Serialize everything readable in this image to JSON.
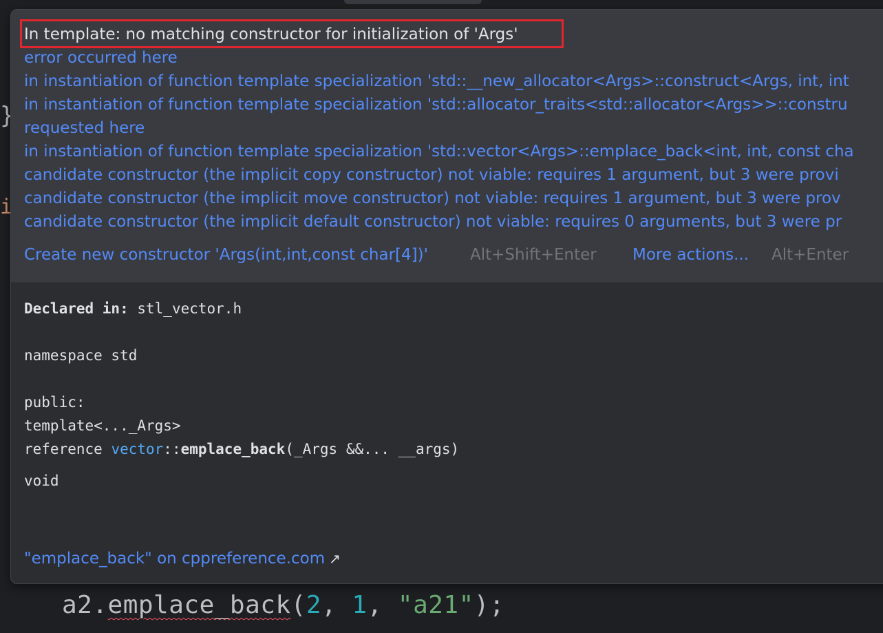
{
  "editor": {
    "brace_fragment": "}",
    "i_fragment": "i",
    "code_line": {
      "object": "a2.",
      "method": "emplace_back",
      "open": "(",
      "arg1": "2",
      "sep1": ", ",
      "arg2": "1",
      "sep2": ", ",
      "arg3": "\"a21\"",
      "close": ");"
    }
  },
  "popup": {
    "error_title": "In template: no matching constructor for initialization of 'Args'",
    "messages": [
      "error occurred here",
      "in instantiation of function template specialization 'std::__new_allocator<Args>::construct<Args, int, int",
      "in instantiation of function template specialization 'std::allocator_traits<std::allocator<Args>>::constru",
      "requested here",
      "in instantiation of function template specialization 'std::vector<Args>::emplace_back<int, int, const cha",
      "candidate constructor (the implicit copy constructor) not viable: requires 1 argument, but 3 were provi",
      "candidate constructor (the implicit move constructor) not viable: requires 1 argument, but 3 were prov",
      "candidate constructor (the implicit default constructor) not viable: requires 0 arguments, but 3 were pr"
    ],
    "actions": {
      "create_constructor_label": "Create new constructor 'Args(int,int,const char[4])'",
      "create_constructor_shortcut": "Alt+Shift+Enter",
      "more_actions_label": "More actions...",
      "more_actions_shortcut": "Alt+Enter"
    },
    "docs": {
      "declared_label": "Declared in:",
      "declared_file": "stl_vector.h",
      "namespace_line": "namespace std",
      "access_line": "public:",
      "template_line": "template<..._Args>",
      "sig_return": "reference ",
      "sig_class": "vector",
      "sig_scope": "::",
      "sig_method": "emplace_back",
      "sig_params": "(_Args &&... __args)",
      "return_type": "void"
    },
    "external_link": {
      "label": "\"emplace_back\" on cppreference.com",
      "icon": "external-arrow-icon"
    }
  },
  "colors": {
    "error_border": "#e0262e",
    "link": "#548af7",
    "popup_bg": "#2b2d30",
    "problems_bg": "#393b40"
  }
}
